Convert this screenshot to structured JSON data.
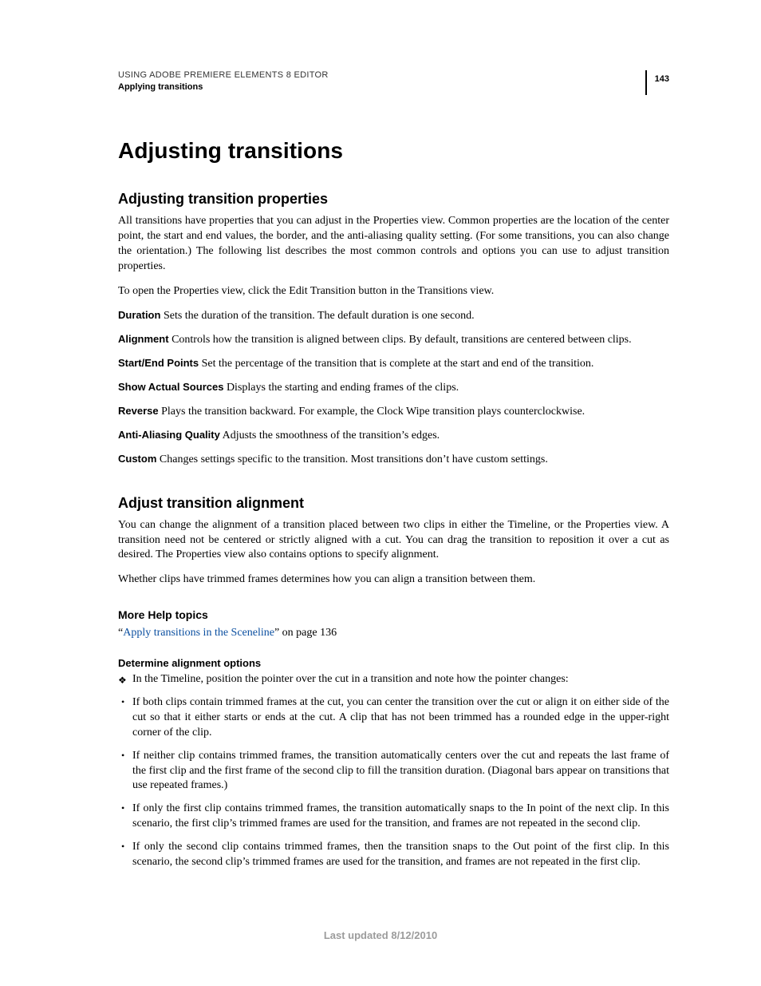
{
  "header": {
    "product": "USING ADOBE PREMIERE ELEMENTS 8 EDITOR",
    "section": "Applying transitions",
    "page_number": "143"
  },
  "h1": "Adjusting transitions",
  "sec1": {
    "title": "Adjusting transition properties",
    "para1": "All transitions have properties that you can adjust in the Properties view. Common properties are the location of the center point, the start and end values, the border, and the anti-aliasing quality setting. (For some transitions, you can also change the orientation.) The following list describes the most common controls and options you can use to adjust transition properties.",
    "para2": "To open the Properties view, click the Edit Transition button in the Transitions view.",
    "props": [
      {
        "term": "Duration",
        "desc": "Sets the duration of the transition. The default duration is one second."
      },
      {
        "term": "Alignment",
        "desc": "Controls how the transition is aligned between clips. By default, transitions are centered between clips."
      },
      {
        "term": "Start/End Points",
        "desc": "Set the percentage of the transition that is complete at the start and end of the transition."
      },
      {
        "term": "Show Actual Sources",
        "desc": "Displays the starting and ending frames of the clips."
      },
      {
        "term": "Reverse",
        "desc": "Plays the transition backward. For example, the Clock Wipe transition plays counterclockwise."
      },
      {
        "term": "Anti-Aliasing Quality",
        "desc": "Adjusts the smoothness of the transition’s edges."
      },
      {
        "term": "Custom",
        "desc": "Changes settings specific to the transition. Most transitions don’t have custom settings."
      }
    ]
  },
  "sec2": {
    "title": "Adjust transition alignment",
    "para1": "You can change the alignment of a transition placed between two clips in either the Timeline, or the Properties view. A transition need not be centered or strictly aligned with a cut. You can drag the transition to reposition it over a cut as desired. The Properties view also contains options to specify alignment.",
    "para2": "Whether clips have trimmed frames determines how you can align a transition between them.",
    "more_help_heading": "More Help topics",
    "xref_quote_open": "“",
    "xref_text": "Apply transitions in the Sceneline",
    "xref_suffix": "” on page 136",
    "sub_title": "Determine alignment options",
    "lead": "In the Timeline, position the pointer over the cut in a transition and note how the pointer changes:",
    "bullets": [
      "If both clips contain trimmed frames at the cut, you can center the transition over the cut or align it on either side of the cut so that it either starts or ends at the cut. A clip that has not been trimmed has a rounded edge in the upper-right corner of the clip.",
      "If neither clip contains trimmed frames, the transition automatically centers over the cut and repeats the last frame of the first clip and the first frame of the second clip to fill the transition duration. (Diagonal bars appear on transitions that use repeated frames.)",
      "If only the first clip contains trimmed frames, the transition automatically snaps to the In point of the next clip. In this scenario, the first clip’s trimmed frames are used for the transition, and frames are not repeated in the second clip.",
      "If only the second clip contains trimmed frames, then the transition snaps to the Out point of the first clip. In this scenario, the second clip’s trimmed frames are used for the transition, and frames are not repeated in the first clip."
    ]
  },
  "footer": "Last updated 8/12/2010"
}
